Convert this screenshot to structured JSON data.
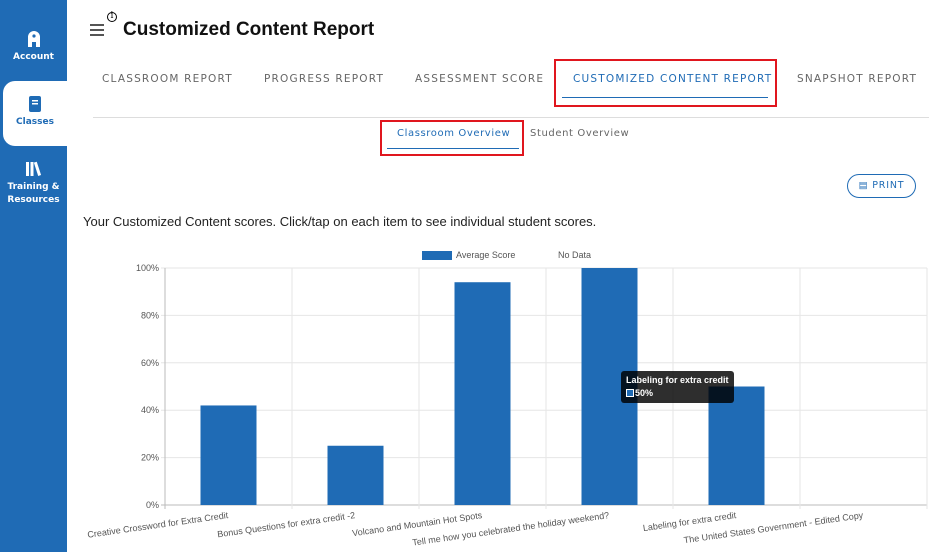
{
  "sidebar": {
    "items": [
      {
        "label": "Account",
        "icon": "account-icon"
      },
      {
        "label": "Classes",
        "icon": "book-icon",
        "active": true
      },
      {
        "label": "Training & Resources",
        "icon": "library-icon"
      }
    ]
  },
  "header": {
    "title": "Customized Content Report",
    "info_icon": "ⓘ"
  },
  "tabs": [
    {
      "label": "CLASSROOM REPORT"
    },
    {
      "label": "PROGRESS REPORT"
    },
    {
      "label": "ASSESSMENT SCORE"
    },
    {
      "label": "CUSTOMIZED CONTENT REPORT",
      "active": true
    },
    {
      "label": "SNAPSHOT REPORT"
    }
  ],
  "subtabs": [
    {
      "label": "Classroom Overview",
      "active": true
    },
    {
      "label": "Student Overview"
    }
  ],
  "print_label": "PRINT",
  "intro": "Your Customized Content scores. Click/tap on each item to see individual student scores.",
  "colors": {
    "brand": "#1f6bb5",
    "highlight": "#e0161e"
  },
  "tooltip": {
    "title": "Labeling for extra credit",
    "value": "50%"
  },
  "chart_data": {
    "type": "bar",
    "categories": [
      "Creative Crossword for Extra Credit",
      "Bonus Questions for extra credit -2",
      "Volcano and Mountain Hot Spots",
      "Tell me how you celebrated the holiday weekend?",
      "Labeling for extra credit",
      "The United States Government - Edited Copy"
    ],
    "series": [
      {
        "name": "Average Score",
        "values": [
          42,
          25,
          94,
          100,
          50,
          0
        ],
        "color": "#1f6bb5"
      },
      {
        "name": "No Data",
        "values": []
      }
    ],
    "ylim": [
      0,
      100
    ],
    "yticks": [
      "0%",
      "20%",
      "40%",
      "60%",
      "80%",
      "100%"
    ],
    "grid": true,
    "legend": "top"
  }
}
